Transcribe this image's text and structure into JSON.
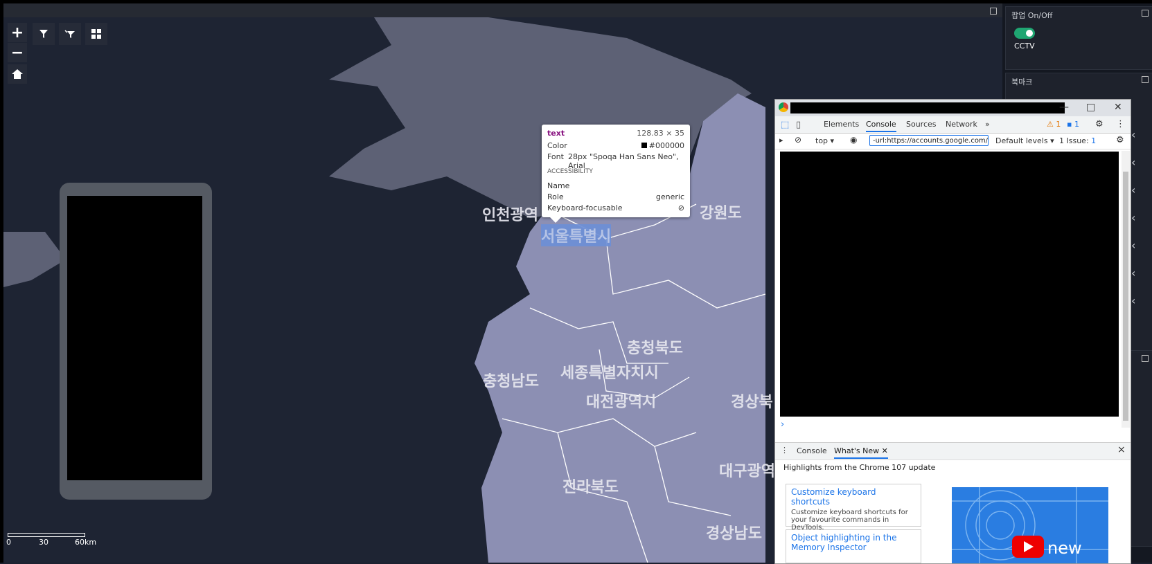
{
  "map": {
    "regions": {
      "incheon": "인천광역",
      "seoul": "서울특별시",
      "gangwon": "강원도",
      "chungbuk": "충청북도",
      "chungnam": "충청남도",
      "sejong": "세종특별자치시",
      "daejeon": "대전광역시",
      "gyeongbuk": "경상북",
      "jeonbuk": "전라북도",
      "daegu": "대구광역",
      "gyeongnam": "경상남도"
    },
    "scale": {
      "labels": [
        "0",
        "30",
        "60km"
      ]
    },
    "colors": {
      "sea": "#1e2433",
      "land_north": "#5d6175",
      "land_south": "#8c8fb3",
      "border": "#ffffff"
    }
  },
  "tools": {
    "zoom_in": "+",
    "zoom_out": "−",
    "icons": [
      "zoom-in-icon",
      "zoom-out-icon",
      "home-icon",
      "filter-icon",
      "filter-clear-icon",
      "grid-icon"
    ]
  },
  "side": {
    "popup_title": "팝업 On/Off",
    "popup_toggle_on": true,
    "cctv_label": "CCTV",
    "bookmark_title": "북마크"
  },
  "tooltip": {
    "tag": "text",
    "size": "128.83 × 35",
    "color_label": "Color",
    "color_value": "#000000",
    "font_label": "Font",
    "font_value": "28px \"Spoqa Han Sans Neo\", Arial",
    "section": "ACCESSIBILITY",
    "name_label": "Name",
    "role_label": "Role",
    "role_value": "generic",
    "focus_label": "Keyboard-focusable"
  },
  "devtools": {
    "tabs": [
      "Elements",
      "Console",
      "Sources",
      "Network"
    ],
    "active_tab": "Console",
    "more": "»",
    "warnings": "1",
    "messages": "1",
    "context": "top",
    "filter": "-url:https://accounts.google.com/",
    "levels": "Default levels",
    "issues_label": "1 Issue:",
    "issues_count": "1",
    "prompt": "›",
    "drawer_tabs": [
      "Console",
      "What's New"
    ],
    "drawer_close": "×",
    "highlights": "Highlights from the Chrome 107 update",
    "cards": [
      {
        "title": "Customize keyboard shortcuts",
        "desc": "Customize keyboard shortcuts for your favourite commands in DevTools."
      },
      {
        "title": "Object highlighting in the Memory Inspector",
        "desc": ""
      }
    ],
    "promo_text": "new"
  }
}
